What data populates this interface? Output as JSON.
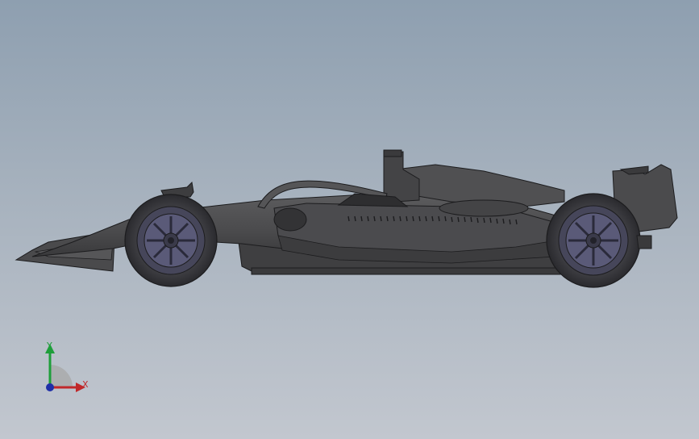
{
  "viewport": {
    "background_top": "#8e9fb0",
    "background_bottom": "#c2c7cf"
  },
  "model": {
    "body_color": "#4d4d4f",
    "body_dark": "#333335",
    "edge_color": "#1c1c1e",
    "wheel_rim_color": "#5a5a78"
  },
  "triad": {
    "x_label": "X",
    "y_label": "Y",
    "x_color": "#c0282a",
    "y_color": "#1e9e3a",
    "z_color": "#1f2fa8"
  }
}
